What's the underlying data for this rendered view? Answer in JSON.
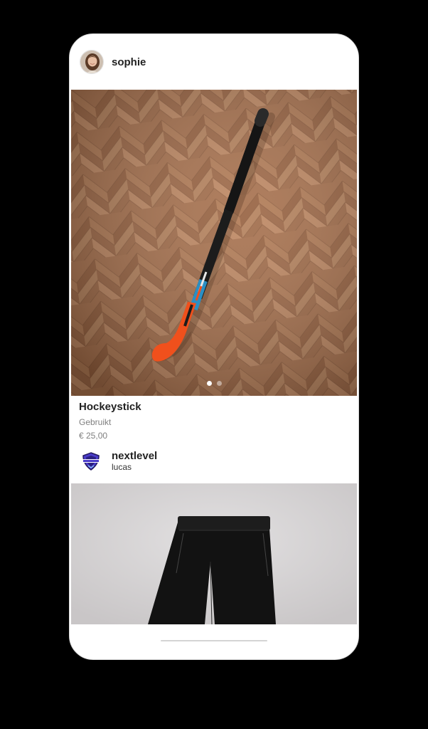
{
  "post": {
    "username": "sophie",
    "images_total": 2,
    "image_active_index": 0,
    "image_subject": "hockey-stick-on-parquet-floor"
  },
  "item": {
    "title": "Hockeystick",
    "condition": "Gebruikt",
    "price": "€ 25,00"
  },
  "seller": {
    "name": "nextlevel",
    "user": "lucas",
    "logo_icon": "shield-badge-logo"
  },
  "next_post": {
    "image_subject": "black-sport-pants"
  },
  "colors": {
    "background": "#000000",
    "card": "#ffffff",
    "title_text": "#222222",
    "secondary_text": "#808080",
    "stick_blade": "#f0501c",
    "stick_shaft": "#1c1c1c",
    "stick_accent": "#2b8fc4",
    "seller_badge": "#4a3cc9"
  }
}
